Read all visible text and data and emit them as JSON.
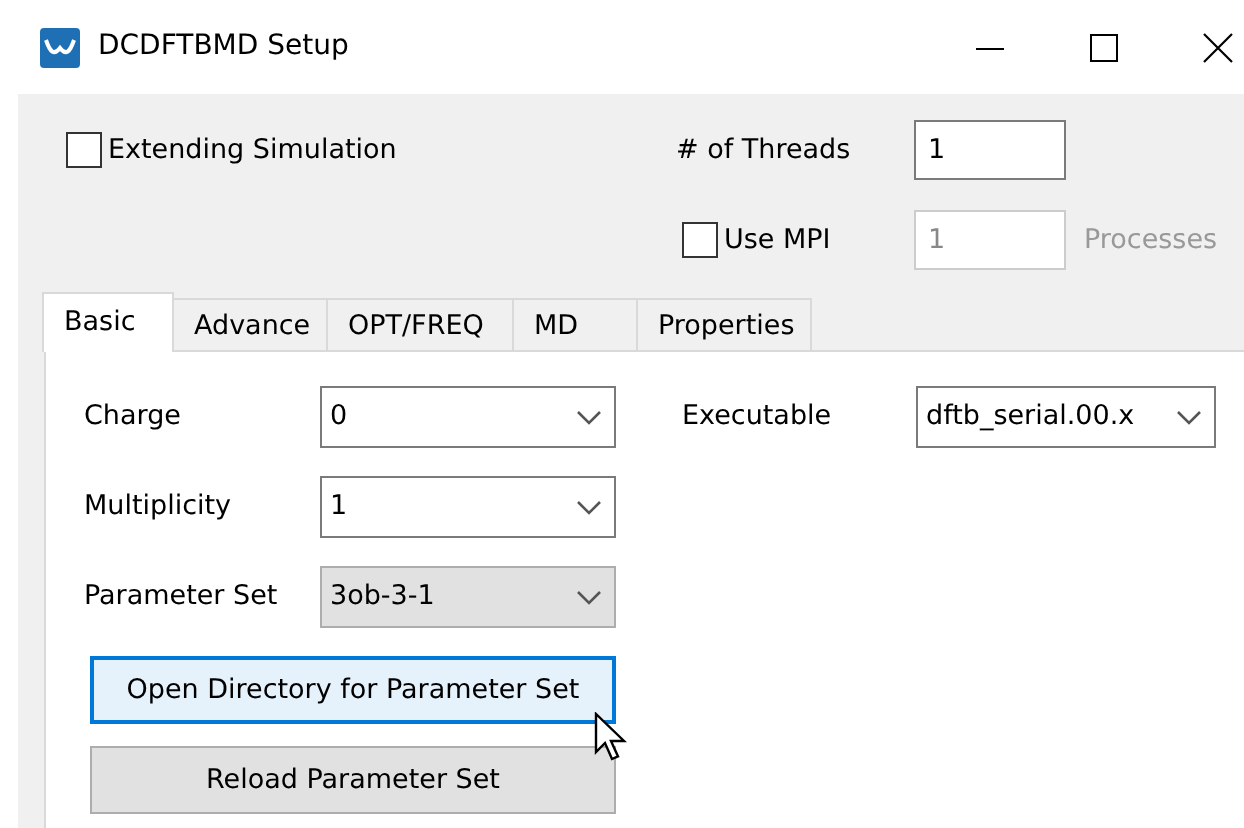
{
  "window": {
    "title": "DCDFTBMD Setup"
  },
  "extending_simulation": {
    "label": "Extending Simulation",
    "checked": false
  },
  "threads": {
    "label": "# of Threads",
    "value": "1"
  },
  "use_mpi": {
    "label": "Use MPI",
    "checked": false
  },
  "processes": {
    "value": "1",
    "label": "Processes",
    "disabled": true
  },
  "tabs": [
    {
      "label": "Basic",
      "selected": true
    },
    {
      "label": "Advance",
      "selected": false
    },
    {
      "label": "OPT/FREQ",
      "selected": false
    },
    {
      "label": "MD",
      "selected": false
    },
    {
      "label": "Properties",
      "selected": false
    }
  ],
  "fields": [
    {
      "label": "Charge",
      "value": "0",
      "disabled": false
    },
    {
      "label": "Multiplicity",
      "value": "1",
      "disabled": false
    },
    {
      "label": "Parameter Set",
      "value": "3ob-3-1",
      "disabled": true
    }
  ],
  "executable": {
    "label": "Executable",
    "value": "dftb_serial.00.x",
    "disabled": false
  },
  "buttons": [
    {
      "label": "Open Directory for Parameter Set",
      "hovered": true
    },
    {
      "label": "Reload Parameter Set",
      "hovered": false
    }
  ]
}
